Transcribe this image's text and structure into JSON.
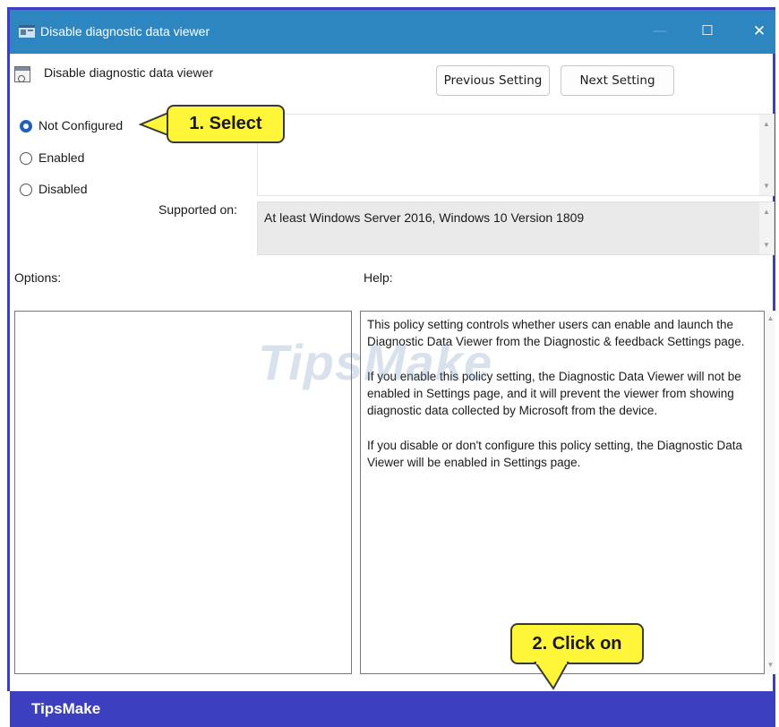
{
  "window": {
    "title": "Disable diagnostic data viewer",
    "controls": {
      "minimize": "—",
      "maximize": "☐",
      "close": "✕"
    }
  },
  "header": {
    "setting_name": "Disable diagnostic data viewer",
    "previous_button": "Previous Setting",
    "next_button": "Next Setting"
  },
  "state": {
    "options": [
      {
        "label": "Not Configured",
        "checked": true
      },
      {
        "label": "Enabled",
        "checked": false
      },
      {
        "label": "Disabled",
        "checked": false
      }
    ]
  },
  "supported": {
    "label": "Supported on:",
    "value": "At least Windows Server 2016, Windows 10 Version 1809"
  },
  "panes": {
    "options_label": "Options:",
    "help_label": "Help:",
    "help_paragraphs": [
      "This policy setting controls whether users can enable and launch the Diagnostic Data Viewer from the Diagnostic & feedback Settings page.",
      "If you enable this policy setting, the Diagnostic Data Viewer will not be enabled in Settings page, and it will prevent the viewer from showing diagnostic data collected by Microsoft from the device.",
      "If you disable or don't configure this policy setting, the Diagnostic Data Viewer will be enabled in Settings page."
    ]
  },
  "annotations": {
    "callout_select": "1. Select",
    "callout_click": "2. Click on"
  },
  "watermark": "TipsMake",
  "footer": {
    "brand": "TipsMake"
  },
  "colors": {
    "titlebar": "#2e86c1",
    "footer": "#3b3fc0",
    "callout": "#fff63a",
    "radio_selected": "#1c62b9"
  }
}
